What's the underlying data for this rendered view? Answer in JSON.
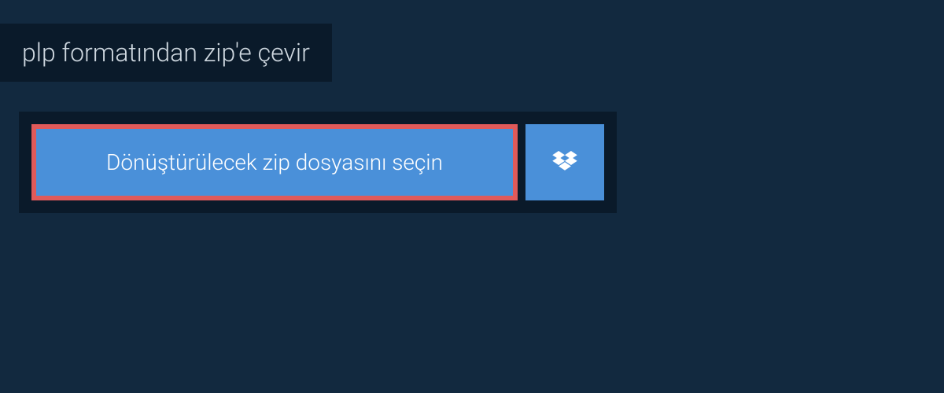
{
  "header": {
    "title": "plp formatından zip'e çevir"
  },
  "upload": {
    "select_file_label": "Dönüştürülecek zip dosyasını seçin",
    "dropbox_icon_name": "dropbox-icon"
  },
  "colors": {
    "background": "#12293f",
    "panel": "#0a1a2a",
    "button": "#4a90d9",
    "highlight_border": "#e05a5a",
    "text_light": "#cfd8e0",
    "text_white": "#ffffff"
  }
}
